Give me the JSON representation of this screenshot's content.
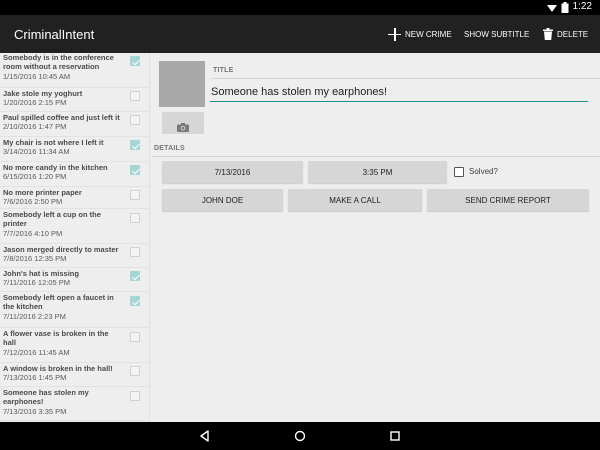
{
  "status_bar": {
    "time": "1:22"
  },
  "action_bar": {
    "title": "CriminalIntent",
    "new_crime_label": "NEW CRIME",
    "show_subtitle_label": "SHOW SUBTITLE",
    "delete_label": "DELETE"
  },
  "crimes": [
    {
      "title": "Somebody is in the conference room without a reservation",
      "date": "1/15/2016 10:45 AM",
      "solved": true
    },
    {
      "title": "Jake stole my yoghurt",
      "date": "1/20/2016 2:15 PM",
      "solved": false
    },
    {
      "title": "Paul spilled coffee and just left it",
      "date": "2/10/2016 1:47 PM",
      "solved": false
    },
    {
      "title": "My chair is not where I left it",
      "date": "3/14/2016 11:34 AM",
      "solved": true
    },
    {
      "title": "No more candy in the kitchen",
      "date": "6/15/2016 1:20 PM",
      "solved": true
    },
    {
      "title": "No more printer paper",
      "date": "7/6/2016 2:50 PM",
      "solved": false
    },
    {
      "title": "Somebody left a cup on the printer",
      "date": "7/7/2016 4:10 PM",
      "solved": false
    },
    {
      "title": "Jason merged directly to master",
      "date": "7/8/2016 12:35 PM",
      "solved": false
    },
    {
      "title": "John's hat is missing",
      "date": "7/11/2016 12:05 PM",
      "solved": true
    },
    {
      "title": "Somebody left open a faucet in the kitchen",
      "date": "7/11/2016 2:23 PM",
      "solved": true
    },
    {
      "title": "A flower vase is broken in the hall",
      "date": "7/12/2016 11:45 AM",
      "solved": false
    },
    {
      "title": "A window is broken in the hall!",
      "date": "7/13/2016 1:45 PM",
      "solved": false
    },
    {
      "title": "Someone has stolen my earphones!",
      "date": "7/13/2016 3:35 PM",
      "solved": false
    }
  ],
  "detail": {
    "title_label": "TITLE",
    "title_value": "Someone has stolen my earphones!",
    "details_label": "DETAILS",
    "date_button": "7/13/2016",
    "time_button": "3:35 PM",
    "solved_label": "Solved?",
    "solved": false,
    "suspect_button": "JOHN DOE",
    "call_button": "MAKE A CALL",
    "report_button": "SEND CRIME REPORT"
  },
  "icons": {
    "add": "plus-icon",
    "delete": "trash-icon",
    "camera": "camera-icon",
    "wifi": "wifi-icon",
    "battery": "battery-icon",
    "back": "back-icon",
    "home": "home-icon",
    "recents": "recents-icon"
  },
  "colors": {
    "action_bar": "#212121",
    "accent": "#1a8f86",
    "checked": "#a5d6d3",
    "background": "#eeeeee"
  }
}
